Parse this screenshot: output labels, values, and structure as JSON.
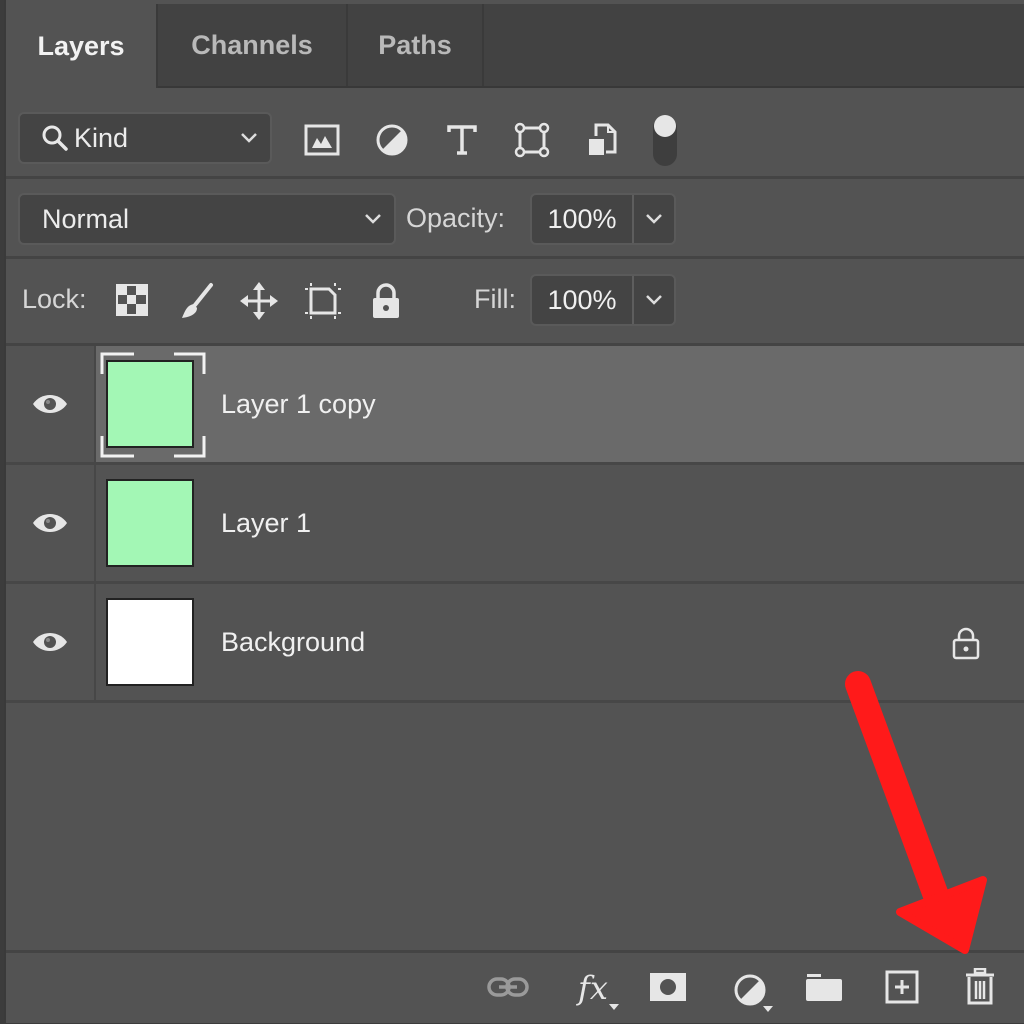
{
  "tabs": [
    {
      "label": "Layers",
      "active": true
    },
    {
      "label": "Channels",
      "active": false
    },
    {
      "label": "Paths",
      "active": false
    }
  ],
  "filter": {
    "kind_label": "Kind",
    "icons": [
      "pixel-layer-filter-icon",
      "adjustment-layer-filter-icon",
      "type-layer-filter-icon",
      "shape-layer-filter-icon",
      "smart-object-filter-icon",
      "filter-toggle-switch"
    ]
  },
  "blend": {
    "mode": "Normal",
    "opacity_label": "Opacity:",
    "opacity_value": "100%"
  },
  "lock": {
    "label": "Lock:",
    "icons": [
      "lock-transparent-pixels-icon",
      "lock-image-pixels-icon",
      "lock-position-icon",
      "lock-artboard-icon",
      "lock-all-icon"
    ],
    "fill_label": "Fill:",
    "fill_value": "100%"
  },
  "layers": [
    {
      "name": "Layer 1 copy",
      "visible": true,
      "selected": true,
      "thumb_color": "#a3f7b5",
      "locked": false
    },
    {
      "name": "Layer 1",
      "visible": true,
      "selected": false,
      "thumb_color": "#a3f7b5",
      "locked": false
    },
    {
      "name": "Background",
      "visible": true,
      "selected": false,
      "thumb_color": "#ffffff",
      "locked": true
    }
  ],
  "footer": {
    "icons": [
      "link-layers-icon",
      "layer-style-fx-icon",
      "add-mask-icon",
      "new-adjustment-layer-icon",
      "new-group-icon",
      "new-layer-icon",
      "delete-layer-icon"
    ],
    "fx_label": "fx"
  },
  "annotation": {
    "type": "arrow",
    "color": "#ff1a1a",
    "points_to": "delete-layer-icon"
  }
}
